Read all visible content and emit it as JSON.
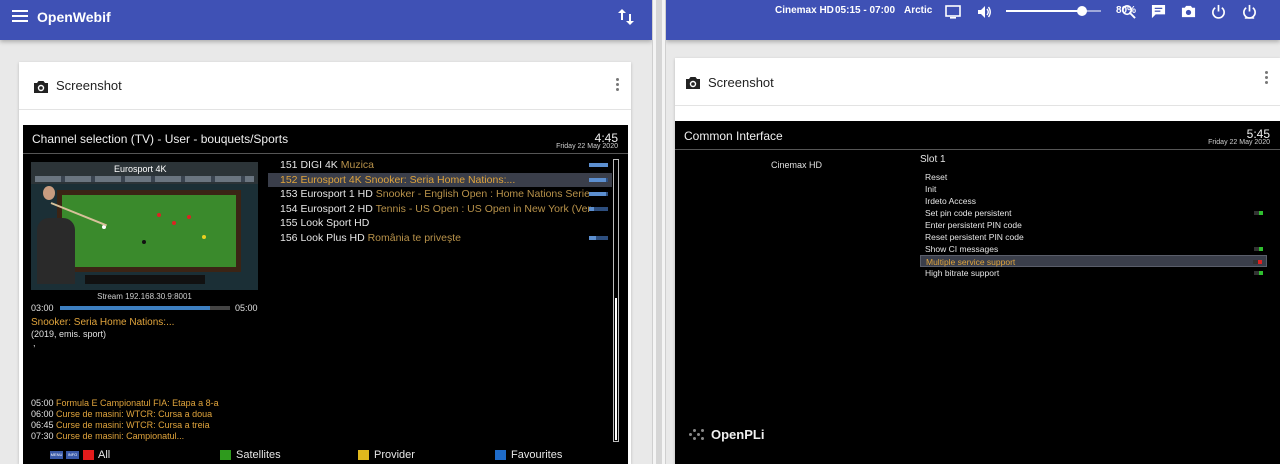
{
  "left": {
    "topbar": {
      "brand": "OpenWebif",
      "menu_icon": "hamburger-menu-icon",
      "sort_icon": "swap-vertical-icon"
    },
    "card": {
      "title": "Screenshot",
      "icon": "camera-icon",
      "menu_icon": "more-vertical-icon"
    },
    "tv": {
      "title": "Channel selection (TV) - User - bouquets/Sports",
      "time": "4:45",
      "date": "Friday 22 May 2020",
      "preview": {
        "channel_label": "Eurosport 4K",
        "stream": "Stream 192.168.30.9:8001",
        "start": "03:00",
        "end": "05:00",
        "progress": 0.88
      },
      "event_title": "Snooker: Seria Home Nations:...",
      "event_sub": "(2019, emis. sport)",
      "event_extra": ",",
      "epg": [
        {
          "time": "05:00",
          "name": "Formula E Campionatul FIA: Etapa a 8-a"
        },
        {
          "time": "06:00",
          "name": "Curse de masini: WTCR: Cursa a doua"
        },
        {
          "time": "06:45",
          "name": "Curse de masini: WTCR: Cursa a treia"
        },
        {
          "time": "07:30",
          "name": "Curse de masini: Campionatul..."
        }
      ],
      "channels": [
        {
          "num": "151",
          "name": "DIGI 4K",
          "event": "Muzica",
          "progress": 1.0,
          "selected": false
        },
        {
          "num": "152",
          "name": "Eurosport 4K",
          "event": "Snooker: Seria Home Nations:...",
          "progress": 0.9,
          "selected": true
        },
        {
          "num": "153",
          "name": "Eurosport 1 HD",
          "event": "Snooker - English Open : Home Nations Serie",
          "progress": 0.9,
          "selected": false
        },
        {
          "num": "154",
          "name": "Eurosport 2 HD",
          "event": "Tennis - US Open : US Open in New York (Ver",
          "progress": 0.25,
          "selected": false
        },
        {
          "num": "155",
          "name": "Look Sport HD",
          "event": "",
          "progress": null,
          "selected": false
        },
        {
          "num": "156",
          "name": "Look Plus HD",
          "event": "România te priveşte",
          "progress": 0.35,
          "selected": false
        }
      ],
      "footer": {
        "menu_key": "MENU",
        "info_key": "INFO",
        "buttons": [
          {
            "color": "#e31b1b",
            "label": "All"
          },
          {
            "color": "#2e9a1d",
            "label": "Satellites"
          },
          {
            "color": "#e0b81d",
            "label": "Provider"
          },
          {
            "color": "#1e6bc9",
            "label": "Favourites"
          }
        ]
      }
    }
  },
  "right": {
    "topbar": {
      "channel": "Cinemax HD",
      "time_range": "05:15 - 07:00",
      "event": "Arctic",
      "volume": "80%",
      "volume_level": 0.8,
      "icons": [
        "tv-icon",
        "volume-icon",
        "search-icon",
        "message-icon",
        "camera-icon",
        "power-standby-icon",
        "power-icon"
      ]
    },
    "card": {
      "title": "Screenshot",
      "icon": "camera-icon",
      "menu_icon": "more-vertical-icon"
    },
    "ci": {
      "title": "Common Interface",
      "time": "5:45",
      "date": "Friday 22 May 2020",
      "channel": "Cinemax HD",
      "slot": "Slot 1",
      "items": [
        {
          "label": "Reset",
          "toggle": null,
          "selected": false
        },
        {
          "label": "Init",
          "toggle": null,
          "selected": false
        },
        {
          "label": "Irdeto Access",
          "toggle": null,
          "selected": false
        },
        {
          "label": "Set pin code persistent",
          "toggle": "#2fbf2f",
          "selected": false
        },
        {
          "label": "Enter persistent PIN code",
          "toggle": null,
          "selected": false
        },
        {
          "label": "Reset persistent PIN code",
          "toggle": null,
          "selected": false
        },
        {
          "label": "Show CI messages",
          "toggle": "#2fbf2f",
          "selected": false
        },
        {
          "label": "Multiple service support",
          "toggle": "#e02020",
          "selected": true
        },
        {
          "label": "High bitrate support",
          "toggle": "#2fbf2f",
          "selected": false
        }
      ],
      "logo": "OpenPLi"
    }
  },
  "colors": {
    "topbar": "#3f51b5",
    "accent_orange": "#e0a43c",
    "screen_bg": "#000000"
  }
}
